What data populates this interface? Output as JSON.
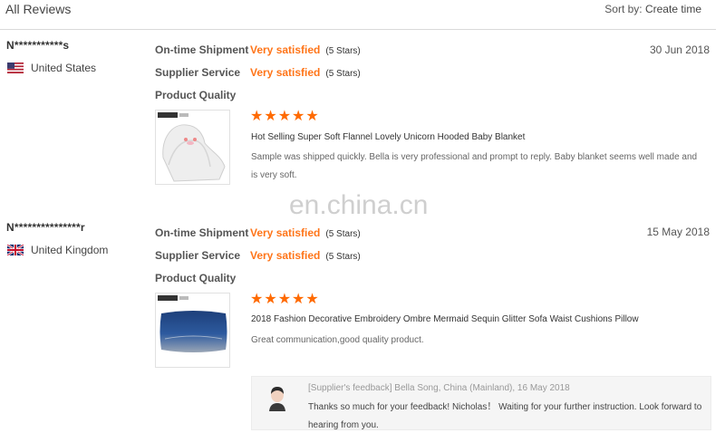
{
  "header": {
    "title": "All Reviews",
    "sort_label": "Sort by:",
    "sort_value": "Create time"
  },
  "rating_labels": {
    "shipment": "On-time Shipment",
    "service": "Supplier Service",
    "quality": "Product Quality"
  },
  "reviews": [
    {
      "buyer": "N***********s",
      "country": "United States",
      "flag": "us-flag-icon",
      "date": "30 Jun 2018",
      "shipment_value": "Very satisfied",
      "shipment_stars": "(5 Stars)",
      "service_value": "Very satisfied",
      "service_stars": "(5 Stars)",
      "quality_stars": 5,
      "product_name": "Hot Selling Super Soft Flannel Lovely Unicorn Hooded Baby Blanket",
      "comment": "Sample was shipped quickly. Bella is very professional and prompt to reply. Baby blanket seems well made and is very soft."
    },
    {
      "buyer": "N***************r",
      "country": "United Kingdom",
      "flag": "uk-flag-icon",
      "date": "15 May 2018",
      "shipment_value": "Very satisfied",
      "shipment_stars": "(5 Stars)",
      "service_value": "Very satisfied",
      "service_stars": "(5 Stars)",
      "quality_stars": 5,
      "product_name": "2018 Fashion Decorative Embroidery Ombre Mermaid Sequin Glitter Sofa Waist Cushions Pillow",
      "comment": "Great communication,good quality product.",
      "feedback": {
        "meta": "[Supplier's feedback] Bella Song, China (Mainland), 16 May 2018",
        "text": "Thanks so much for your feedback! Nicholas！ Waiting for your further instruction. Look forward to hearing from you."
      }
    }
  ],
  "watermark": "en.china.cn",
  "colors": {
    "accent": "#ff7519",
    "star": "#ff6a00"
  }
}
